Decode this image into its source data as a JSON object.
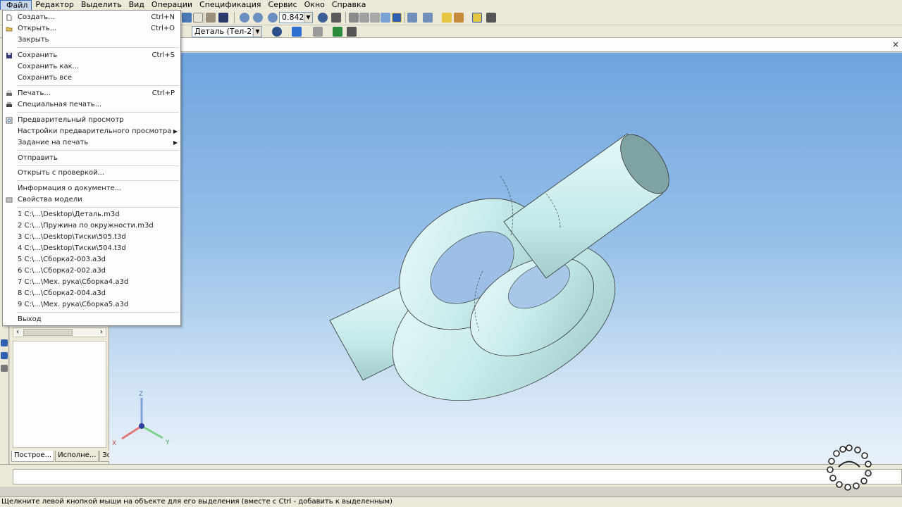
{
  "menubar": {
    "items": [
      "Файл",
      "Редактор",
      "Выделить",
      "Вид",
      "Операции",
      "Спецификация",
      "Сервис",
      "Окно",
      "Справка"
    ]
  },
  "toolbar": {
    "zoom_value": "0.8420",
    "part_selector": "Деталь (Тел-2)"
  },
  "file_menu": {
    "items": [
      {
        "label": "Создать...",
        "shortcut": "Ctrl+N",
        "icon": "new-document-icon"
      },
      {
        "label": "Открыть...",
        "shortcut": "Ctrl+O",
        "icon": "open-folder-icon"
      },
      {
        "label": "Закрыть",
        "shortcut": ""
      },
      {
        "label": "Сохранить",
        "shortcut": "Ctrl+S",
        "icon": "save-icon"
      },
      {
        "label": "Сохранить как...",
        "shortcut": ""
      },
      {
        "label": "Сохранить все",
        "shortcut": ""
      },
      {
        "label": "Печать...",
        "shortcut": "Ctrl+P",
        "icon": "print-icon"
      },
      {
        "label": "Специальная печать...",
        "shortcut": "",
        "icon": "special-print-icon"
      },
      {
        "label": "Предварительный просмотр",
        "shortcut": "",
        "icon": "preview-icon"
      },
      {
        "label": "Настройки предварительного просмотра",
        "shortcut": "",
        "submenu": true
      },
      {
        "label": "Задание на печать",
        "shortcut": "",
        "submenu": true
      },
      {
        "label": "Отправить",
        "shortcut": ""
      },
      {
        "label": "Открыть с проверкой...",
        "shortcut": ""
      },
      {
        "label": "Информация о документе...",
        "shortcut": ""
      },
      {
        "label": "Свойства модели",
        "shortcut": "",
        "icon": "model-properties-icon"
      },
      {
        "label": "1 C:\\...\\Desktop\\Деталь.m3d",
        "shortcut": ""
      },
      {
        "label": "2 C:\\...\\Пружина по окружности.m3d",
        "shortcut": ""
      },
      {
        "label": "3 C:\\...\\Desktop\\Тиски\\505.t3d",
        "shortcut": ""
      },
      {
        "label": "4 C:\\...\\Desktop\\Тиски\\504.t3d",
        "shortcut": ""
      },
      {
        "label": "5 C:\\...\\Сборка2-003.a3d",
        "shortcut": ""
      },
      {
        "label": "6 C:\\...\\Сборка2-002.a3d",
        "shortcut": ""
      },
      {
        "label": "7 C:\\...\\Мех. рука\\Сборка4.a3d",
        "shortcut": ""
      },
      {
        "label": "8 C:\\...\\Сборка2-004.a3d",
        "shortcut": ""
      },
      {
        "label": "9 C:\\...\\Мех. рука\\Сборка5.a3d",
        "shortcut": ""
      },
      {
        "label": "Выход",
        "shortcut": ""
      }
    ]
  },
  "tree_panel": {
    "tabs": [
      "Построе...",
      "Исполне...",
      "Зоны"
    ]
  },
  "axes": {
    "x": "X",
    "y": "Y",
    "z": "Z"
  },
  "status": {
    "hint": "Щелкните левой кнопкой мыши на объекте для его выделения (вместе с Ctrl - добавить к выделенным)"
  },
  "colors": {
    "model_fill": "#c9ecec",
    "viewport_top": "#6fa4de",
    "viewport_bottom": "#e9f1fa",
    "menu_highlight": "#316ac5"
  }
}
